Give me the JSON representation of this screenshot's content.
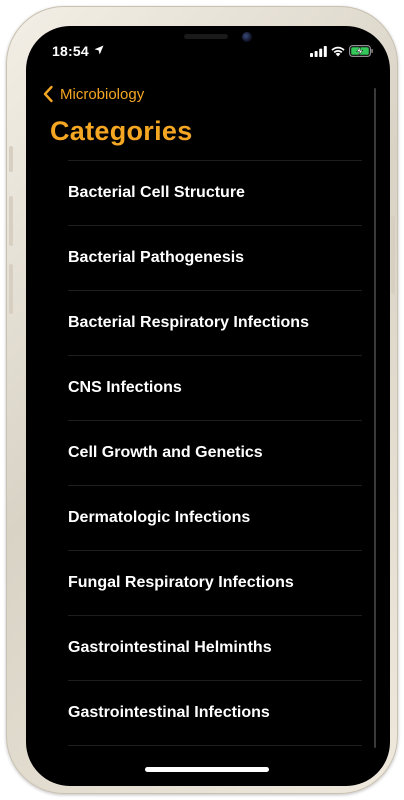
{
  "status_bar": {
    "time": "18:54",
    "location_icon": "location-arrow-icon",
    "signal_icon": "cellular-signal-icon",
    "wifi_icon": "wifi-icon",
    "battery_icon": "battery-charging-icon"
  },
  "nav": {
    "back_label": "Microbiology",
    "back_icon": "chevron-left-icon"
  },
  "title": "Categories",
  "colors": {
    "accent": "#f5a623",
    "background": "#000000",
    "text": "#ffffff",
    "battery_fill": "#34c759"
  },
  "categories": [
    {
      "label": "Bacterial Cell Structure"
    },
    {
      "label": "Bacterial Pathogenesis"
    },
    {
      "label": "Bacterial Respiratory Infections"
    },
    {
      "label": "CNS Infections"
    },
    {
      "label": "Cell Growth and Genetics"
    },
    {
      "label": "Dermatologic Infections"
    },
    {
      "label": "Fungal Respiratory Infections"
    },
    {
      "label": "Gastrointestinal Helminths"
    },
    {
      "label": "Gastrointestinal Infections"
    }
  ]
}
